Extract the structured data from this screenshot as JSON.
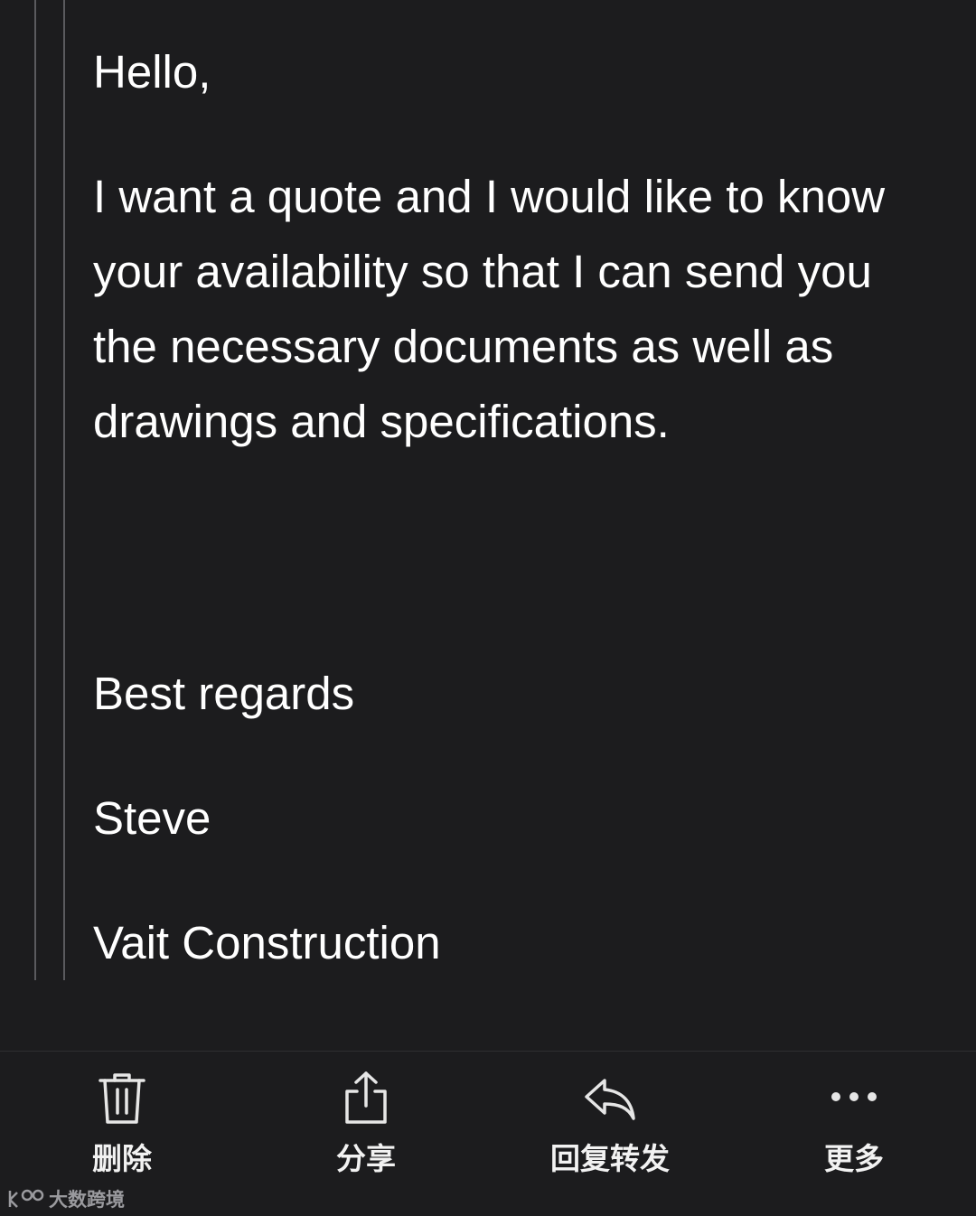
{
  "message": {
    "greeting": "Hello,",
    "paragraph": "I want a quote and I would like to know your availability so that I can send you the necessary documents as well as drawings and specifications.",
    "closing": "Best regards",
    "sender_name": "Steve",
    "company": "Vait Construction"
  },
  "toolbar": {
    "delete": {
      "label": "删除",
      "icon": "trash-icon"
    },
    "share": {
      "label": "分享",
      "icon": "share-icon"
    },
    "reply": {
      "label": "回复转发",
      "icon": "reply-icon"
    },
    "more": {
      "label": "更多",
      "icon": "ellipsis-icon"
    }
  },
  "watermark": {
    "text": "大数跨境"
  },
  "colors": {
    "background": "#1c1c1e",
    "text": "#ffffff",
    "quote_bar": "#5a5a5e",
    "icon": "#e6e6e6"
  }
}
